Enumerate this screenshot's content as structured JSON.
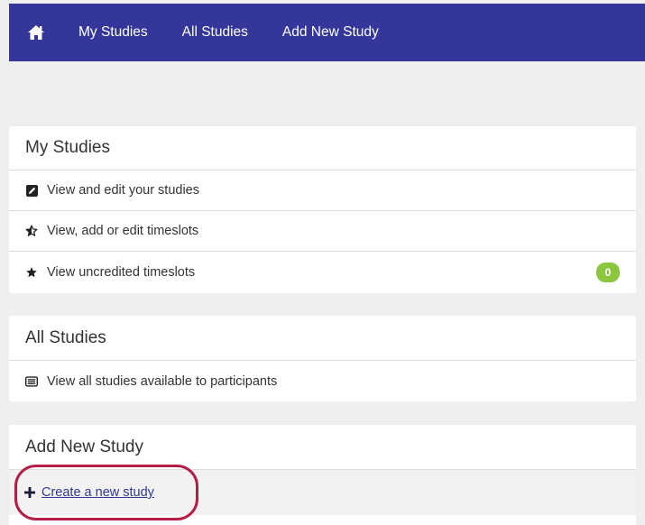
{
  "nav": {
    "home_icon": "home-icon",
    "links": [
      {
        "label": "My Studies"
      },
      {
        "label": "All Studies"
      },
      {
        "label": "Add New Study"
      }
    ]
  },
  "my_studies": {
    "title": "My Studies",
    "items": [
      {
        "label": "View and edit your studies",
        "icon": "edit-square-icon"
      },
      {
        "label": "View, add or edit timeslots",
        "icon": "star-half-icon"
      },
      {
        "label": "View uncredited timeslots",
        "icon": "star-icon",
        "badge": "0"
      }
    ]
  },
  "all_studies": {
    "title": "All Studies",
    "items": [
      {
        "label": "View all studies available to participants",
        "icon": "list-box-icon"
      }
    ]
  },
  "add_new_study": {
    "title": "Add New Study",
    "create_label": " Create a new study",
    "icon": "plus-icon"
  },
  "colors": {
    "navbar": "#34369a",
    "badge": "#8cc63e",
    "highlight": "#b41f48",
    "link": "#34369a"
  }
}
